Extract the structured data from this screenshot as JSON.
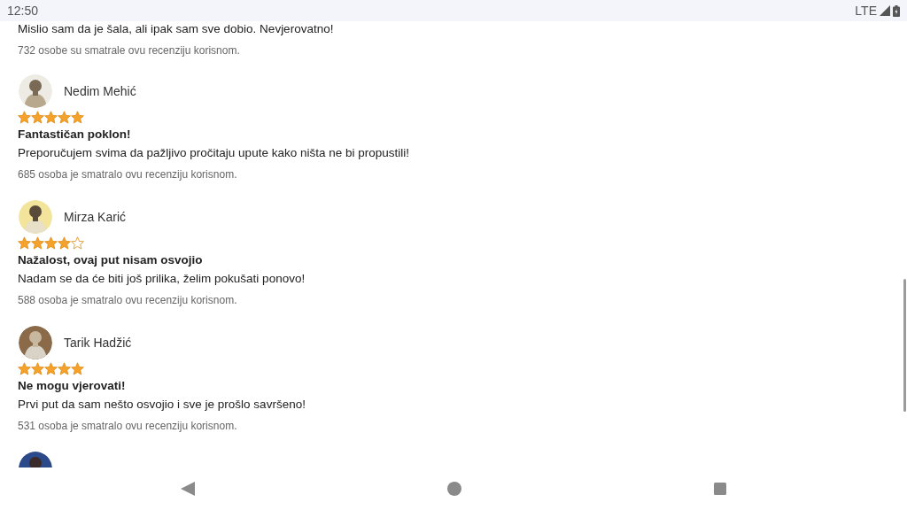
{
  "status_bar": {
    "time": "12:50",
    "network": "LTE"
  },
  "reviews": [
    {
      "kind": "partial",
      "body": "Mislio sam da je šala, ali ipak sam sve dobio. Nevjerovatno!",
      "helpful": "732 osobe su smatrale ovu recenziju korisnom."
    },
    {
      "kind": "full",
      "name": "Nedim Mehić",
      "stars": 5,
      "title": "Fantastičan poklon!",
      "body": "Preporučujem svima da pažljivo pročitaju upute kako ništa ne bi propustili!",
      "helpful": "685 osoba je smatralo ovu recenziju korisnom."
    },
    {
      "kind": "full",
      "name": "Mirza Karić",
      "stars": 4,
      "title": "Nažalost, ovaj put nisam osvojio",
      "body": "Nadam se da će biti još prilika, želim pokušati ponovo!",
      "helpful": "588 osoba je smatralo ovu recenziju korisnom."
    },
    {
      "kind": "full",
      "name": "Tarik Hadžić",
      "stars": 5,
      "title": "Ne mogu vjerovati!",
      "body": "Prvi put da sam nešto osvojio i sve je prošlo savršeno!",
      "helpful": "531 osoba je smatralo ovu recenziju korisnom."
    },
    {
      "kind": "header"
    }
  ]
}
